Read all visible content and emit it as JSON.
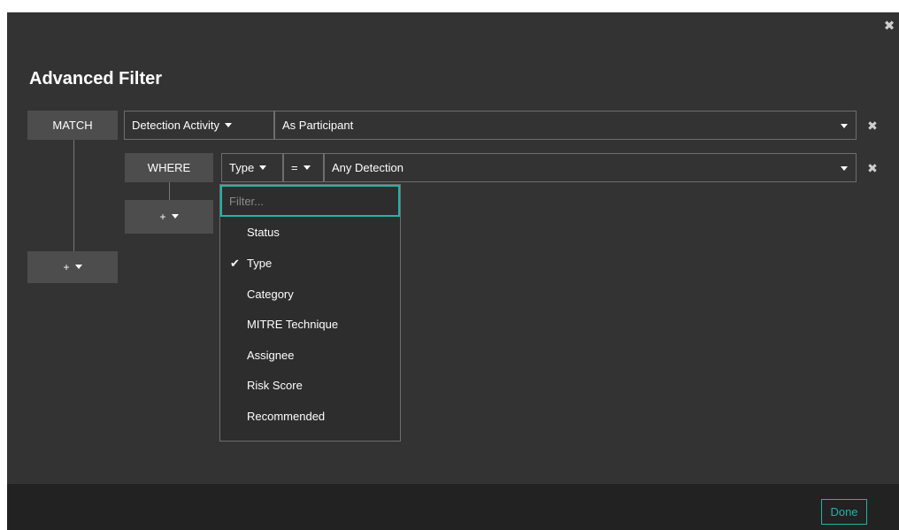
{
  "dialog": {
    "title": "Advanced Filter",
    "close_icon": "close-icon",
    "close_glyph": "✖"
  },
  "match_row": {
    "label": "MATCH",
    "entity_select": "Detection Activity",
    "relation_select": "As Participant",
    "remove_glyph": "✖"
  },
  "where_row": {
    "label": "WHERE",
    "field_select": "Type",
    "operator_select": "=",
    "value_select": "Any Detection",
    "remove_glyph": "✖"
  },
  "add_buttons": {
    "inner_label": "+",
    "outer_label": "+"
  },
  "field_dropdown": {
    "filter_placeholder": "Filter...",
    "check_glyph": "✔",
    "items": [
      {
        "label": "Status",
        "selected": false
      },
      {
        "label": "Type",
        "selected": true
      },
      {
        "label": "Category",
        "selected": false
      },
      {
        "label": "MITRE Technique",
        "selected": false
      },
      {
        "label": "Assignee",
        "selected": false
      },
      {
        "label": "Risk Score",
        "selected": false
      },
      {
        "label": "Recommended",
        "selected": false
      }
    ]
  },
  "footer": {
    "done_label": "Done"
  },
  "colors": {
    "accent": "#1fb5a9",
    "panel": "#333333",
    "footer": "#222222"
  }
}
